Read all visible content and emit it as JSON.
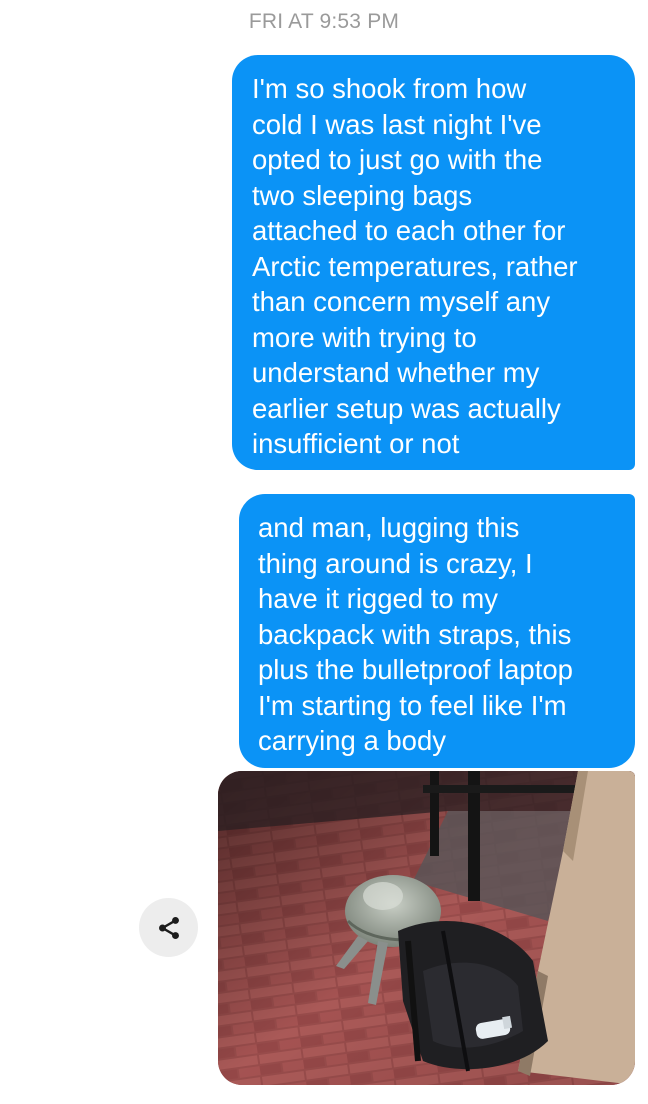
{
  "conversation": {
    "timestamp": "FRI AT 9:53 PM",
    "messages": [
      {
        "lines": [
          "I'm so shook from how",
          "cold I was last night I've",
          "opted to just go with the",
          "two sleeping bags",
          "attached to each other for",
          "Arctic temperatures, rather",
          "than concern myself any",
          "more with trying to",
          "understand whether my",
          "earlier setup was actually",
          "insufficient or not"
        ]
      },
      {
        "lines": [
          "and man, lugging this",
          "thing around is crazy, I",
          "have it rigged to my",
          "backpack with straps, this",
          "plus the bulletproof laptop",
          "I'm starting to feel like I'm",
          "carrying a body"
        ]
      }
    ]
  },
  "colors": {
    "sent_bubble": "#0b93f6",
    "timestamp_text": "#9a9a9a",
    "share_button_bg": "#ededed"
  },
  "icons": {
    "share": "share-icon"
  }
}
